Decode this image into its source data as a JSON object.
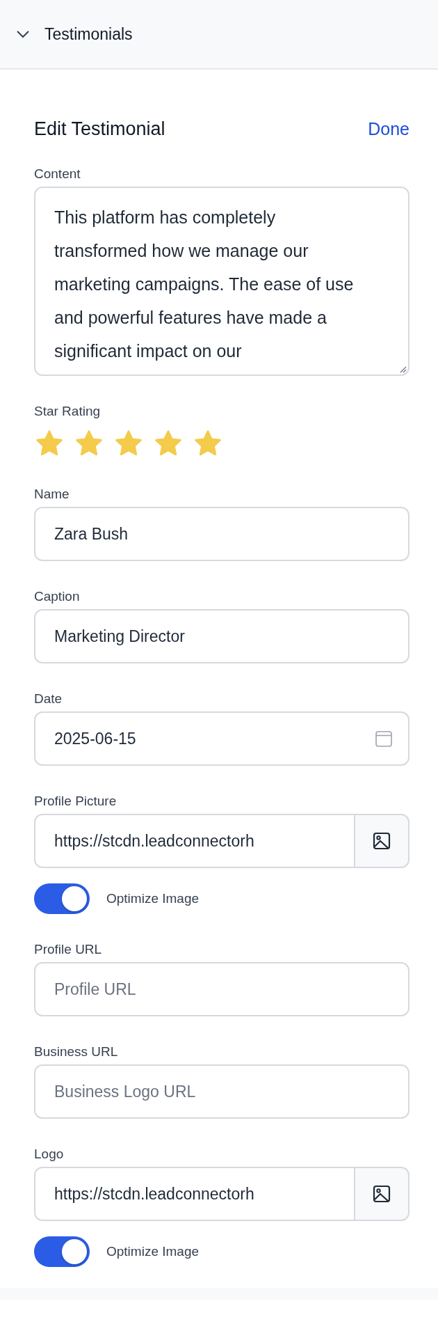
{
  "section": {
    "title": "Testimonials",
    "expanded": true
  },
  "editor": {
    "title": "Edit Testimonial",
    "done": "Done"
  },
  "fields": [
    {
      "kind": "textarea",
      "label": "Content",
      "value": "This platform has completely transformed how we manage our marketing campaigns. The ease of use and powerful features have made a significant impact on our"
    },
    {
      "kind": "stars",
      "label": "Star Rating",
      "stars": 5
    },
    {
      "kind": "text",
      "label": "Name",
      "value": "Zara Bush"
    },
    {
      "kind": "text",
      "label": "Caption",
      "value": "Marketing Director"
    },
    {
      "kind": "date",
      "label": "Date",
      "value": "2025-06-15"
    },
    {
      "kind": "image",
      "label": "Profile Picture",
      "value": "https://stcdn.leadconnectorh"
    },
    {
      "kind": "toggle",
      "label": "Optimize Image",
      "on": true
    },
    {
      "kind": "text",
      "label": "Profile URL",
      "placeholder": "Profile URL"
    },
    {
      "kind": "text",
      "label": "Business URL",
      "placeholder": "Business Logo URL"
    },
    {
      "kind": "image",
      "label": "Logo",
      "value": "https://stcdn.leadconnectorh"
    },
    {
      "kind": "toggle",
      "label": "Optimize Image",
      "on": true
    }
  ]
}
